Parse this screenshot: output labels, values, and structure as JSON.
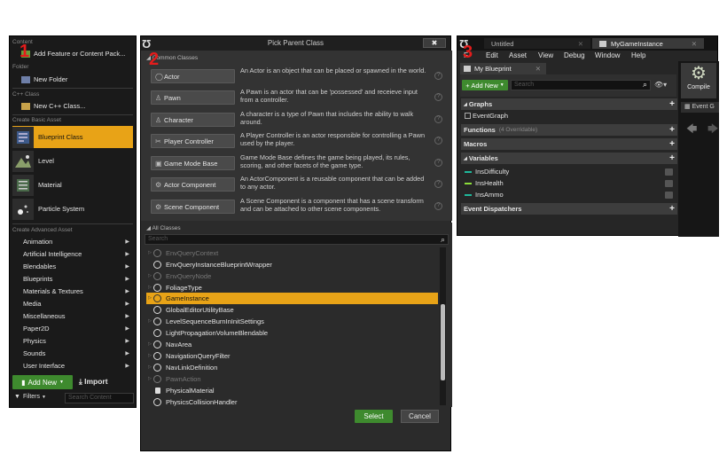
{
  "markers": {
    "one": "1",
    "two": "2",
    "three": "3"
  },
  "content_browser": {
    "section_content": "Content",
    "add_feature": "Add Feature or Content Pack...",
    "section_folder": "Folder",
    "new_folder": "New Folder",
    "section_cpp": "C++ Class",
    "new_cpp": "New C++ Class...",
    "section_basic": "Create Basic Asset",
    "basic_assets": [
      "Blueprint Class",
      "Level",
      "Material",
      "Particle System"
    ],
    "section_advanced": "Create Advanced Asset",
    "advanced_assets": [
      "Animation",
      "Artificial Intelligence",
      "Blendables",
      "Blueprints",
      "Materials & Textures",
      "Media",
      "Miscellaneous",
      "Paper2D",
      "Physics",
      "Sounds",
      "User Interface"
    ],
    "add_new": "Add New",
    "import": "Import",
    "filters": "Filters",
    "search_placeholder": "Search Content"
  },
  "pick_parent": {
    "title": "Pick Parent Class",
    "close": "✖",
    "common_header": "Common Classes",
    "common": [
      {
        "name": "Actor",
        "desc": "An Actor is an object that can be placed or spawned in the world."
      },
      {
        "name": "Pawn",
        "desc": "A Pawn is an actor that can be 'possessed' and receieve input from a controller."
      },
      {
        "name": "Character",
        "desc": "A character is a type of Pawn that includes the ability to walk around."
      },
      {
        "name": "Player Controller",
        "desc": "A Player Controller is an actor responsible for controlling a Pawn used by the player."
      },
      {
        "name": "Game Mode Base",
        "desc": "Game Mode Base defines the game being played, its rules, scoring, and other facets of the game type."
      },
      {
        "name": "Actor Component",
        "desc": "An ActorComponent is a reusable component that can be added to any actor."
      },
      {
        "name": "Scene Component",
        "desc": "A Scene Component is a component that has a scene transform and can be attached to other scene components."
      }
    ],
    "all_header": "All Classes",
    "search_placeholder": "Search",
    "all_classes": [
      "EnvQueryContext",
      "EnvQueryInstanceBlueprintWrapper",
      "EnvQueryNode",
      "FoliageType",
      "GameInstance",
      "GlobalEditorUtilityBase",
      "LevelSequenceBurnInInitSettings",
      "LightPropagationVolumeBlendable",
      "NavArea",
      "NavigationQueryFilter",
      "NavLinkDefinition",
      "PawnAction",
      "PhysicalMaterial",
      "PhysicsCollisionHandler"
    ],
    "select": "Select",
    "cancel": "Cancel"
  },
  "blueprint_editor": {
    "tab_untitled": "Untitled",
    "tab_asset": "MyGameInstance",
    "menu": [
      "File",
      "Edit",
      "Asset",
      "View",
      "Debug",
      "Window",
      "Help"
    ],
    "menu_first_visible": "F",
    "panel_tab": "My Blueprint",
    "add_new": "+ Add New",
    "search_placeholder": "Search",
    "compile": "Compile",
    "event_tab": "Event G",
    "graphs": "Graphs",
    "event_graph": "EventGraph",
    "functions": "Functions",
    "functions_note": "(4 Overridable)",
    "macros": "Macros",
    "variables": "Variables",
    "vars": [
      "InsDifficulty",
      "InsHealth",
      "InsAmmo"
    ],
    "dispatchers": "Event Dispatchers"
  },
  "colors": {
    "accent": "#e8a317",
    "green": "#3e8a2e",
    "marker": "#e41c1c"
  }
}
